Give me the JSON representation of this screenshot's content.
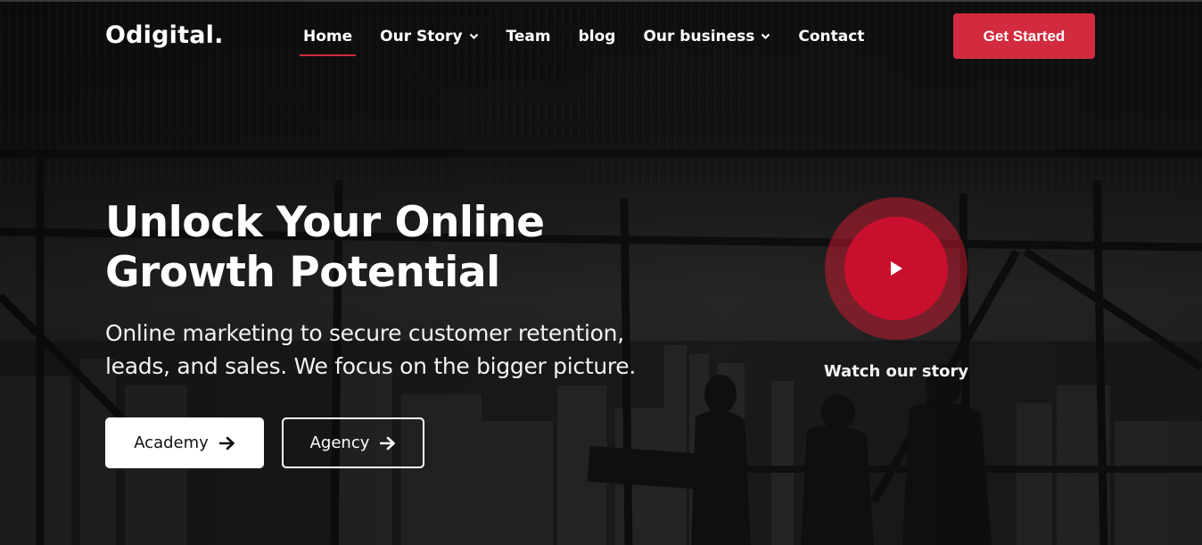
{
  "brand": {
    "logo": "Odigital."
  },
  "nav": {
    "items": [
      {
        "label": "Home",
        "active": true,
        "dropdown": false
      },
      {
        "label": "Our Story",
        "active": false,
        "dropdown": true
      },
      {
        "label": "Team",
        "active": false,
        "dropdown": false
      },
      {
        "label": "blog",
        "active": false,
        "dropdown": false
      },
      {
        "label": "Our business",
        "active": false,
        "dropdown": true
      },
      {
        "label": "Contact",
        "active": false,
        "dropdown": false
      }
    ],
    "cta_label": "Get Started"
  },
  "hero": {
    "headline_line1": "Unlock Your Online",
    "headline_line2": "Growth Potential",
    "subhead_line1": "Online marketing to secure customer retention,",
    "subhead_line2": "leads, and sales. We focus on the bigger picture.",
    "buttons": [
      {
        "label": "Academy",
        "icon": "arrow-right-icon",
        "style": "solid"
      },
      {
        "label": "Agency",
        "icon": "arrow-right-icon",
        "style": "outline"
      }
    ]
  },
  "video": {
    "label": "Watch our story",
    "icon": "play-icon"
  },
  "colors": {
    "accent": "#d22b3f",
    "play": "#c8102e",
    "background": "#1a1a1a"
  }
}
